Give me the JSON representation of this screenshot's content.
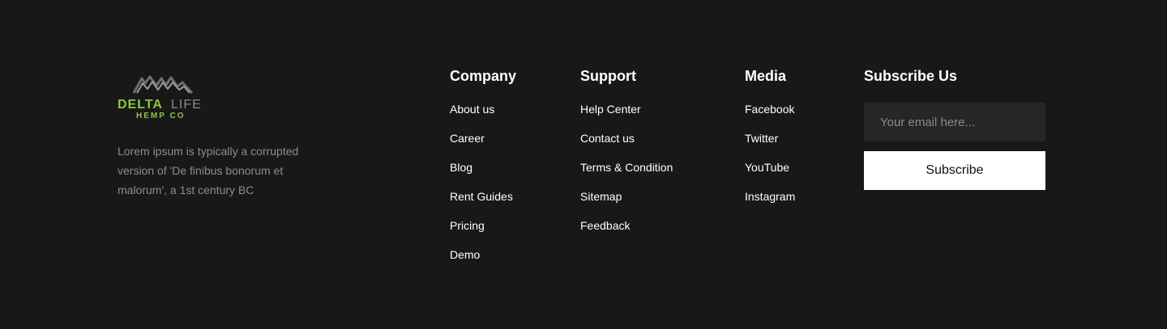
{
  "brand": {
    "logo_name": "DELTALIFE",
    "logo_delta": "DELTA",
    "logo_life": "LIFE",
    "logo_sub": "HEMP CO",
    "description": "Lorem ipsum is typically a corrupted version of 'De finibus bonorum et malorum', a 1st century BC",
    "colors": {
      "green": "#8dc63f",
      "gray": "#8a8a8a"
    }
  },
  "company": {
    "heading": "Company",
    "links": [
      "About us",
      "Career",
      "Blog",
      "Rent Guides",
      "Pricing",
      "Demo"
    ]
  },
  "support": {
    "heading": "Support",
    "links": [
      "Help Center",
      "Contact us",
      "Terms & Condition",
      "Sitemap",
      "Feedback"
    ]
  },
  "media": {
    "heading": "Media",
    "links": [
      "Facebook",
      "Twitter",
      "YouTube",
      "Instagram"
    ]
  },
  "subscribe": {
    "heading": "Subscribe Us",
    "email_placeholder": "Your email here...",
    "email_value": "",
    "button_label": "Subscribe"
  },
  "colors": {
    "background": "#181818",
    "input_background": "#262626",
    "text": "#ffffff",
    "muted_text": "#8d8d8d"
  }
}
